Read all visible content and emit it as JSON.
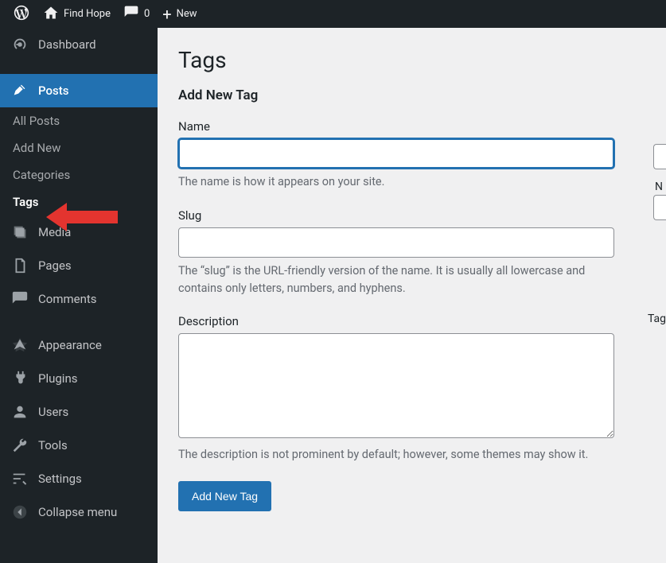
{
  "adminbar": {
    "site_name": "Find Hope",
    "comments_count": "0",
    "new_label": "New"
  },
  "sidebar": {
    "dashboard": "Dashboard",
    "posts": "Posts",
    "posts_sub": {
      "all": "All Posts",
      "add": "Add New",
      "categories": "Categories",
      "tags": "Tags"
    },
    "media": "Media",
    "pages": "Pages",
    "comments": "Comments",
    "appearance": "Appearance",
    "plugins": "Plugins",
    "users": "Users",
    "tools": "Tools",
    "settings": "Settings",
    "collapse": "Collapse menu"
  },
  "page": {
    "title": "Tags",
    "add_heading": "Add New Tag",
    "name_label": "Name",
    "name_help": "The name is how it appears on your site.",
    "slug_label": "Slug",
    "slug_help": "The “slug” is the URL-friendly version of the name. It is usually all lowercase and contains only letters, numbers, and hyphens.",
    "desc_label": "Description",
    "desc_help": "The description is not prominent by default; however, some themes may show it.",
    "submit": "Add New Tag"
  },
  "right_peek": {
    "letter": "N",
    "tag_fragment": "Tag"
  }
}
